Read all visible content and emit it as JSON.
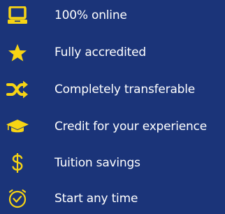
{
  "colors": {
    "background": "#1b3479",
    "icon": "#f7d414",
    "text": "#ffffff"
  },
  "features": [
    {
      "icon": "laptop-icon",
      "label": "100% online"
    },
    {
      "icon": "star-icon",
      "label": "Fully accredited"
    },
    {
      "icon": "shuffle-icon",
      "label": "Completely transferable"
    },
    {
      "icon": "graduation-cap-icon",
      "label": "Credit for your experience"
    },
    {
      "icon": "dollar-sign-icon",
      "label": "Tuition savings"
    },
    {
      "icon": "clock-icon",
      "label": "Start any time"
    }
  ]
}
